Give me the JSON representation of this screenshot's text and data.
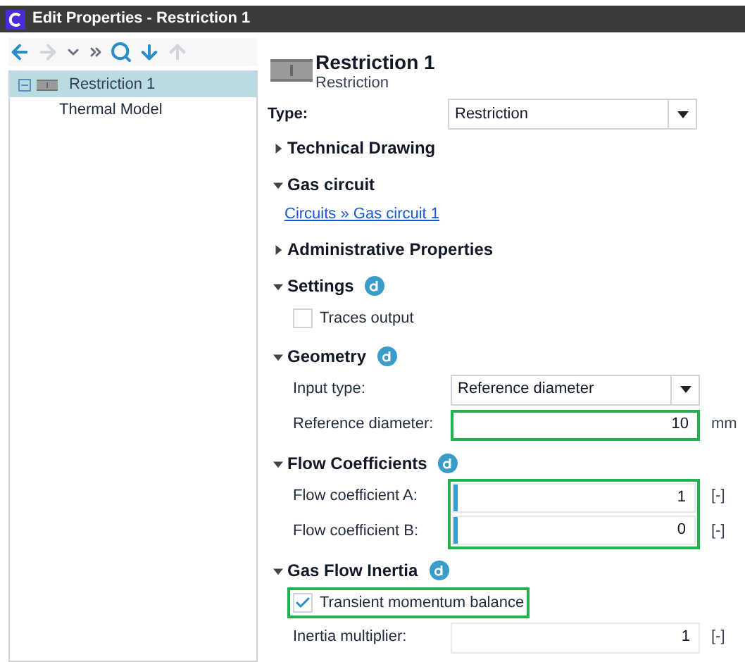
{
  "window": {
    "title": "Edit Properties - Restriction 1"
  },
  "toolbar": [
    {
      "kind": "back",
      "disabled": false
    },
    {
      "kind": "forward",
      "disabled": true
    },
    {
      "kind": "dropdown",
      "disabled": false
    },
    {
      "kind": "skip",
      "disabled": false
    },
    {
      "kind": "search",
      "disabled": false
    },
    {
      "kind": "down",
      "disabled": false
    },
    {
      "kind": "up",
      "disabled": true
    }
  ],
  "tree": [
    {
      "label": "Restriction 1",
      "selected": true,
      "expanded": true,
      "children": [
        {
          "label": "Thermal Model",
          "selected": false
        }
      ]
    }
  ],
  "header": {
    "title": "Restriction 1",
    "subtitle": "Restriction"
  },
  "type_field": {
    "label": "Type:",
    "value": "Restriction"
  },
  "sections": [
    {
      "title": "Technical Drawing",
      "expanded": false,
      "info": false
    },
    {
      "title": "Gas circuit",
      "expanded": true,
      "info": false,
      "rows": [
        {
          "kind": "link",
          "text": "Circuits » Gas circuit 1"
        }
      ]
    },
    {
      "title": "Administrative Properties",
      "expanded": false,
      "info": false
    },
    {
      "title": "Settings",
      "expanded": true,
      "info": true,
      "rows": [
        {
          "kind": "checkbox",
          "label": "Traces output",
          "checked": false,
          "highlighted": false
        }
      ]
    },
    {
      "title": "Geometry",
      "expanded": true,
      "info": true,
      "rows": [
        {
          "kind": "select",
          "label": "Input type:",
          "value": "Reference diameter"
        },
        {
          "kind": "number",
          "label": "Reference diameter:",
          "value": "10",
          "unit": "mm",
          "highlighted": true,
          "marker": false
        }
      ]
    },
    {
      "title": "Flow Coefficients",
      "expanded": true,
      "info": true,
      "highlighted": true,
      "rows": [
        {
          "kind": "number",
          "label": "Flow coefficient A:",
          "value": "1",
          "unit": "[-]",
          "marker": true
        },
        {
          "kind": "number",
          "label": "Flow coefficient B:",
          "value": "0",
          "unit": "[-]",
          "marker": true
        }
      ]
    },
    {
      "title": "Gas Flow Inertia",
      "expanded": true,
      "info": true,
      "rows": [
        {
          "kind": "checkbox",
          "label": "Transient momentum balance",
          "checked": true,
          "highlighted": true
        },
        {
          "kind": "number",
          "label": "Inertia multiplier:",
          "value": "1",
          "unit": "[-]",
          "highlighted": false,
          "marker": false
        }
      ]
    }
  ]
}
